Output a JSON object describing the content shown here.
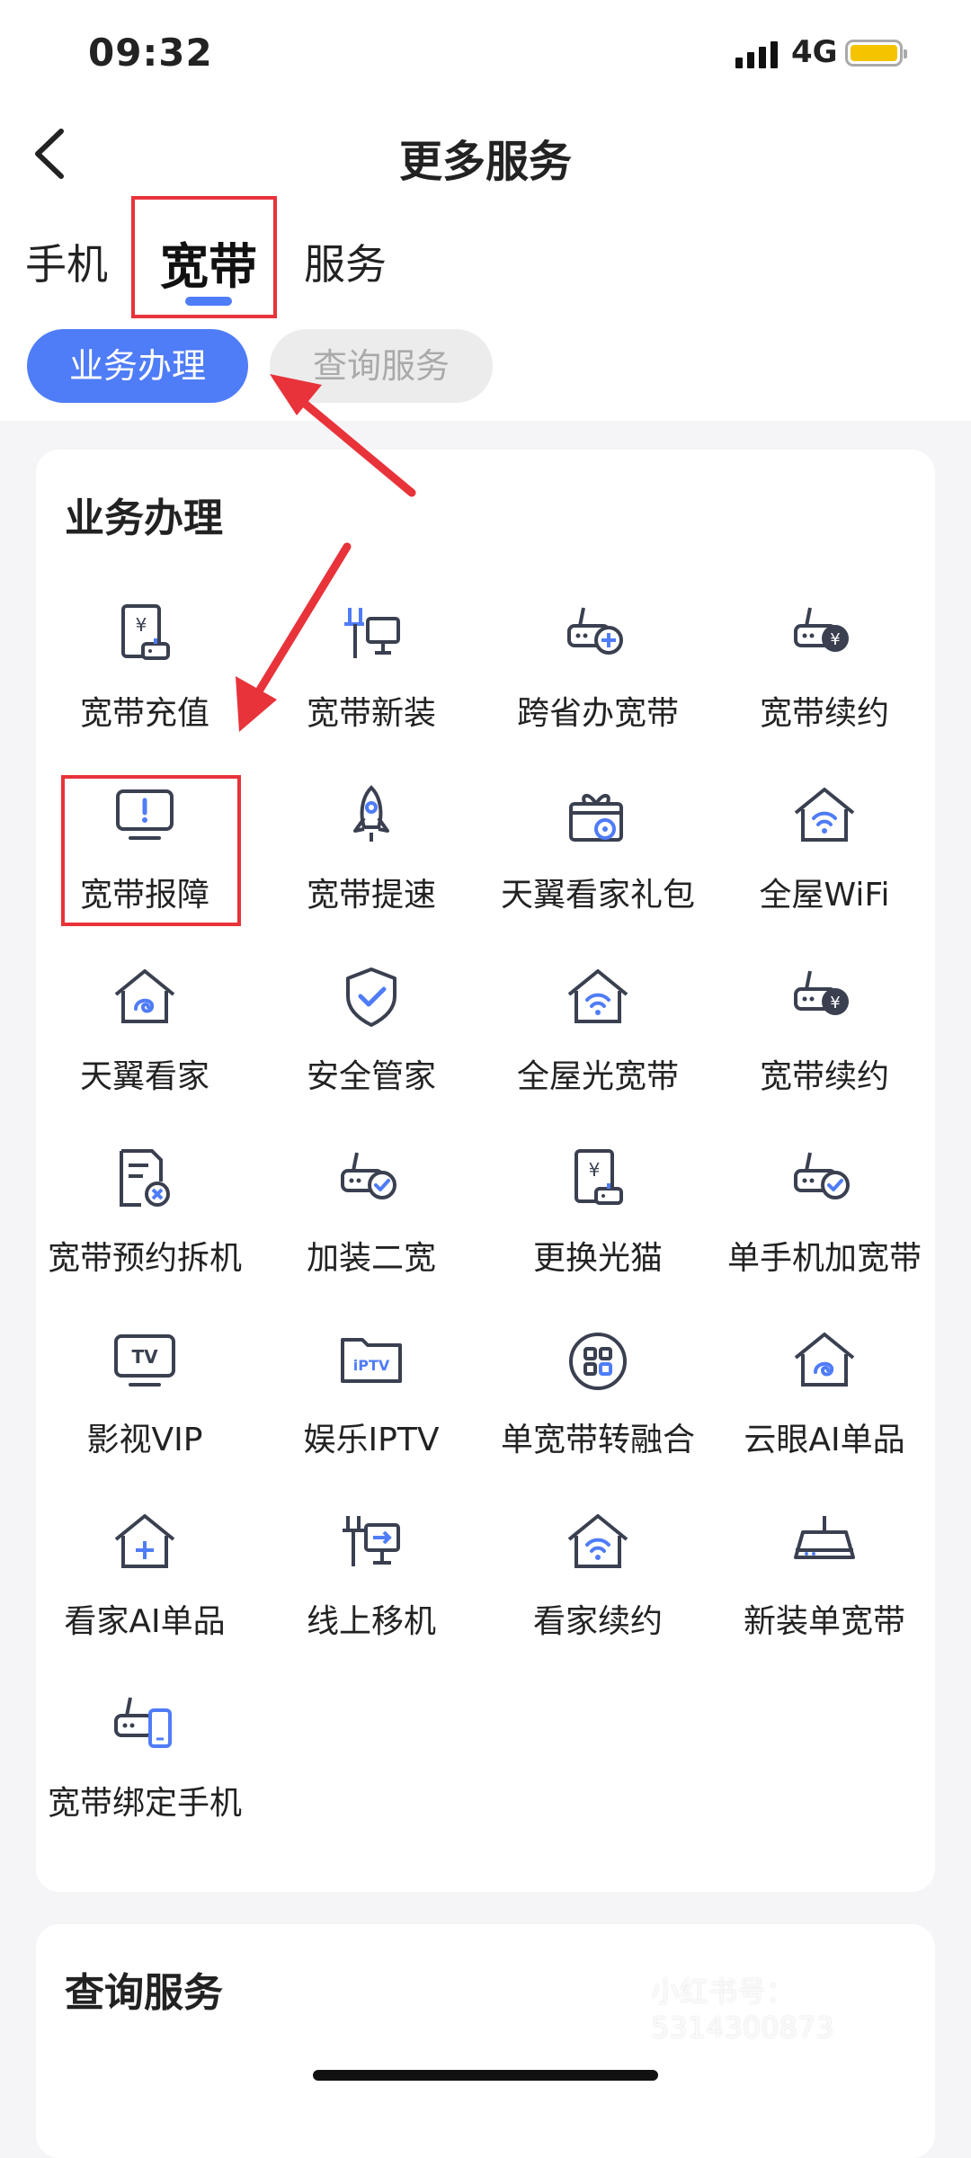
{
  "status_bar": {
    "time": "09:32",
    "network": "4G"
  },
  "nav": {
    "title": "更多服务"
  },
  "tabs": [
    {
      "label": "手机"
    },
    {
      "label": "宽带"
    },
    {
      "label": "服务"
    }
  ],
  "pills": {
    "active": "业务办理",
    "inactive": "查询服务"
  },
  "section1": {
    "title": "业务办理",
    "items": [
      {
        "label": "宽带充值",
        "icon": "broadband-topup-icon"
      },
      {
        "label": "宽带新装",
        "icon": "new-install-icon"
      },
      {
        "label": "跨省办宽带",
        "icon": "router-plus-icon"
      },
      {
        "label": "宽带续约",
        "icon": "router-yuan-icon"
      },
      {
        "label": "宽带报障",
        "icon": "monitor-alert-icon"
      },
      {
        "label": "宽带提速",
        "icon": "rocket-icon"
      },
      {
        "label": "天翼看家礼包",
        "icon": "gift-camera-icon"
      },
      {
        "label": "全屋WiFi",
        "icon": "home-wifi-icon"
      },
      {
        "label": "天翼看家",
        "icon": "home-swirl-icon"
      },
      {
        "label": "安全管家",
        "icon": "shield-check-icon"
      },
      {
        "label": "全屋光宽带",
        "icon": "home-wifi-icon"
      },
      {
        "label": "宽带续约",
        "icon": "router-yuan-icon"
      },
      {
        "label": "宽带预约拆机",
        "icon": "document-cancel-icon"
      },
      {
        "label": "加装二宽",
        "icon": "router-check-icon"
      },
      {
        "label": "更换光猫",
        "icon": "broadband-topup-icon"
      },
      {
        "label": "单手机加宽带",
        "icon": "router-check-icon"
      },
      {
        "label": "影视VIP",
        "icon": "tv-icon"
      },
      {
        "label": "娱乐IPTV",
        "icon": "iptv-folder-icon"
      },
      {
        "label": "单宽带转融合",
        "icon": "grid-circle-icon"
      },
      {
        "label": "云眼AI单品",
        "icon": "home-swirl-icon"
      },
      {
        "label": "看家AI单品",
        "icon": "home-plus-icon"
      },
      {
        "label": "线上移机",
        "icon": "move-install-icon"
      },
      {
        "label": "看家续约",
        "icon": "home-wifi-icon"
      },
      {
        "label": "新装单宽带",
        "icon": "router-icon"
      },
      {
        "label": "宽带绑定手机",
        "icon": "router-phone-icon"
      }
    ]
  },
  "section2": {
    "title": "查询服务"
  },
  "watermark": "小红书号：5314300873",
  "colors": {
    "accent": "#4f7cf7",
    "annotation": "#e8333a",
    "icon_stroke": "#3a4050"
  }
}
